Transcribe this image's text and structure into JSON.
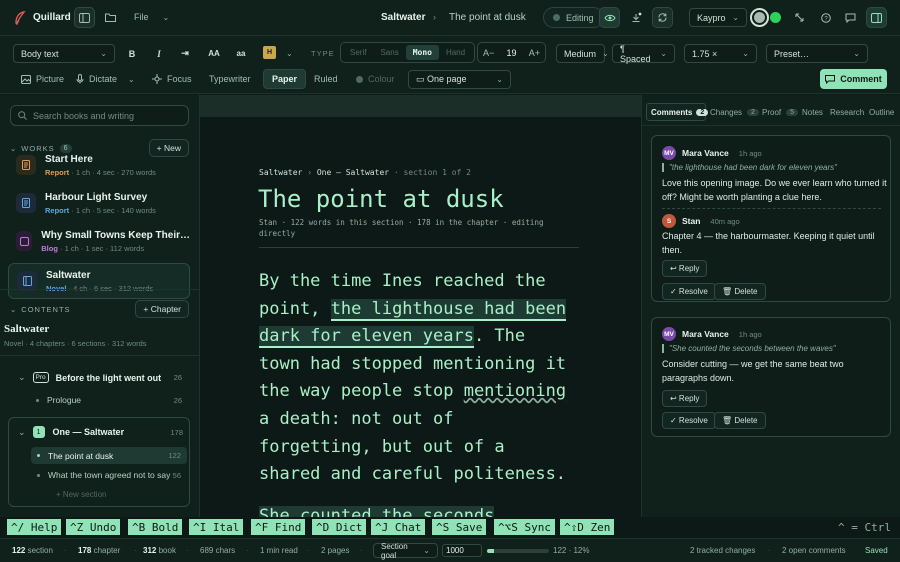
{
  "app": {
    "name": "Quillard",
    "file_menu": "File"
  },
  "header": {
    "doc_title": "Saltwater",
    "section_title": "The point at dusk",
    "mode": "Editing",
    "theme": "Kaypro"
  },
  "format": {
    "style": "Body text",
    "bold": "B",
    "italic": "I",
    "indent": "⇥",
    "upper": "AA",
    "lower": "aa",
    "highlight": "H",
    "type_label": "TYPE",
    "type_options": [
      "Serif",
      "Sans",
      "Mono",
      "Hand"
    ],
    "type_selected": "Mono",
    "size_dec": "A−",
    "size": "19",
    "size_inc": "A+",
    "weight": "Medium",
    "spacing": "¶ Spaced",
    "line_height": "1.75 ×",
    "preset": "Preset…"
  },
  "view": {
    "picture": "Picture",
    "dictate": "Dictate",
    "focus": "Focus",
    "typewriter": "Typewriter",
    "paper": "Paper",
    "ruled": "Ruled",
    "colour": "Colour",
    "layout": "▭ One page",
    "comment_button": "Comment"
  },
  "sidebar": {
    "search_placeholder": "Search books and writing",
    "works_label": "WORKS",
    "works_count": "6",
    "new_label": "+ New",
    "works": [
      {
        "title": "Start Here",
        "kind": "Report",
        "meta": "· 1 ch · 4 sec · 270 words",
        "kind_color": "#e0a050"
      },
      {
        "title": "Harbour Light Survey",
        "kind": "Report",
        "meta": "· 1 ch · 5 sec · 140 words",
        "kind_color": "#5fa8e0"
      },
      {
        "title": "Why Small Towns Keep Their…",
        "kind": "Blog",
        "meta": "· 1 ch · 1 sec · 112 words",
        "kind_color": "#c07ce0"
      },
      {
        "title": "Saltwater",
        "kind": "Novel",
        "meta": "· 4 ch · 6 sec · 312 words",
        "kind_color": "#5fa8e0"
      }
    ],
    "contents_label": "CONTENTS",
    "chapter_button": "+ Chapter",
    "book_title": "Saltwater",
    "book_meta": "Novel · 4 chapters · 6 sections · 312 words",
    "chapters": [
      {
        "badge": "Pro",
        "title": "Before the light went out",
        "count": "26",
        "sections": [
          {
            "title": "Prologue",
            "count": "26"
          }
        ]
      },
      {
        "badge": "1",
        "title": "One — Saltwater",
        "count": "178",
        "sections": [
          {
            "title": "The point at dusk",
            "count": "122"
          },
          {
            "title": "What the town agreed not to say",
            "count": "56"
          }
        ],
        "new_section": "+ New section"
      }
    ]
  },
  "editor": {
    "breadcrumb_book": "Saltwater",
    "breadcrumb_chapter": "One — Saltwater",
    "breadcrumb_section": "· section 1 of 2",
    "title": "The point at dusk",
    "meta_line1": "Stan · 122 words in this section · 178 in the chapter · editing",
    "meta_line2": "directly",
    "p1_before": "By the time Ines reached the point, ",
    "p1_highlight": "the lighthouse had been dark for eleven years",
    "p1_after_a": ". The town had stopped mentioning it the way people stop ",
    "p1_squiggle": "mentioning",
    "p1_after_b": " a death: not out of forgetting, but out of a shared and careful politeness.",
    "p2_start": "She counted the seconds between"
  },
  "comments_panel": {
    "tabs": [
      {
        "label": "Comments",
        "count": "2",
        "active": true
      },
      {
        "label": "Changes",
        "count": "2"
      },
      {
        "label": "Proof",
        "count": "5"
      },
      {
        "label": "Notes"
      },
      {
        "label": "Research"
      },
      {
        "label": "Outline"
      }
    ],
    "threads": [
      {
        "initials": "MV",
        "author": "Mara Vance",
        "time": "1h ago",
        "quote": "\"the lighthouse had been dark for eleven years\"",
        "body_1": "Love this opening image. Do we ever learn who turned it",
        "body_2": "off? Might be worth planting a clue here.",
        "reply": {
          "initials": "S",
          "author": "Stan",
          "time": "40m ago",
          "body_1": "Chapter 4 — the harbourmaster. Keeping it quiet until",
          "body_2": "then."
        },
        "reply_label": "↩ Reply",
        "resolve_label": "✓ Resolve",
        "delete_label": "🗑 Delete"
      },
      {
        "initials": "MV",
        "author": "Mara Vance",
        "time": "1h ago",
        "quote": "\"She counted the seconds between the waves\"",
        "body_1": "Consider cutting — we get the same beat two",
        "body_2": "paragraphs down.",
        "reply_label": "↩ Reply",
        "resolve_label": "✓ Resolve",
        "delete_label": "🗑 Delete"
      }
    ]
  },
  "shortcuts": [
    "^/ Help",
    "^Z Undo",
    "^B Bold",
    "^I Ital",
    "^F Find",
    "^D Dict",
    "^J Chat",
    "^S Save",
    "^⌥S Sync",
    "^⇧D Zen"
  ],
  "shortcut_hint": "^ = Ctrl",
  "status": {
    "section_words": "122",
    "section_label": "section",
    "chapter_words": "178",
    "chapter_label": "chapter",
    "book_words": "312",
    "book_label": "book",
    "chars": "689 chars",
    "read": "1 min read",
    "pages": "2 pages",
    "goal_select": "Section goal",
    "goal_value": "1000",
    "goal_progress": "122 · 12%",
    "goal_fraction": 0.12,
    "tracked": "2 tracked changes",
    "comments": "2 open comments",
    "saved": "Saved"
  },
  "colors": {
    "accent": "#8fe3b7",
    "bg": "#0e1a16",
    "highlight_bg": "#1d3a33"
  }
}
